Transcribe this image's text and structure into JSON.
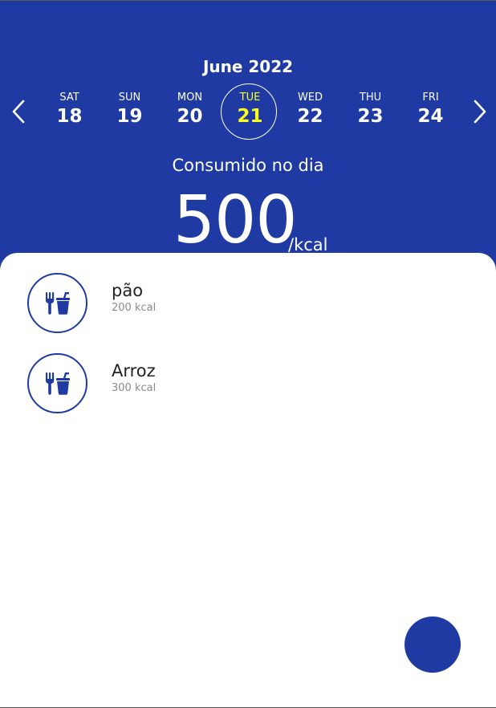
{
  "colors": {
    "header_bg": "#1f3aa2",
    "selected_day": "#ffff1e",
    "accent": "#1f3aa2",
    "muted_text": "#8a8a8a"
  },
  "calendar": {
    "month_title": "June 2022",
    "prev_icon": "chevron-left-icon",
    "next_icon": "chevron-right-icon",
    "selected_index": 3,
    "days": [
      {
        "dow": "SAT",
        "num": "18"
      },
      {
        "dow": "SUN",
        "num": "19"
      },
      {
        "dow": "MON",
        "num": "20"
      },
      {
        "dow": "TUE",
        "num": "21"
      },
      {
        "dow": "WED",
        "num": "22"
      },
      {
        "dow": "THU",
        "num": "23"
      },
      {
        "dow": "FRI",
        "num": "24"
      }
    ]
  },
  "summary": {
    "label": "Consumido no dia",
    "value": "500",
    "unit": "/kcal"
  },
  "foods": [
    {
      "name": "pão",
      "kcal": "200 kcal",
      "icon": "food-drink-icon"
    },
    {
      "name": "Arroz",
      "kcal": "300 kcal",
      "icon": "food-drink-icon"
    }
  ],
  "fab": {
    "icon": "add-food-button"
  }
}
